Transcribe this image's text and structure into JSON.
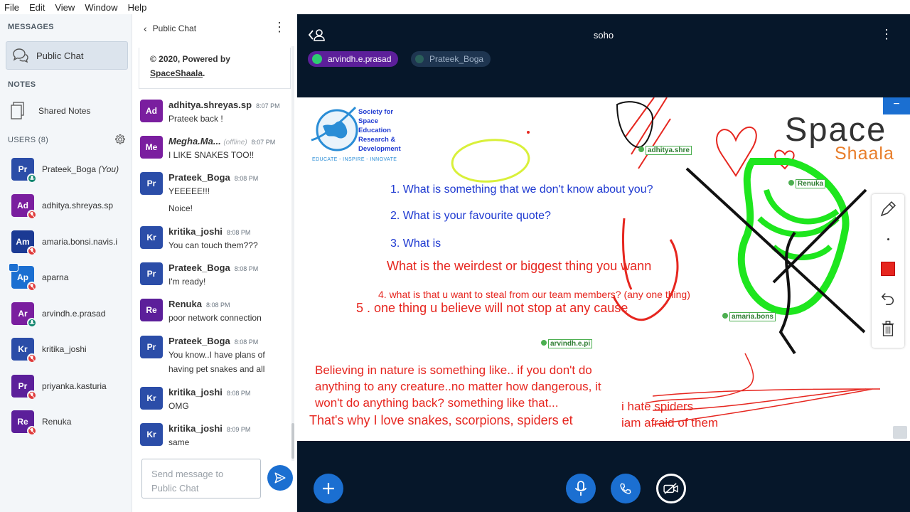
{
  "menu": [
    "File",
    "Edit",
    "View",
    "Window",
    "Help"
  ],
  "sidebar": {
    "messages_label": "MESSAGES",
    "public_chat": "Public Chat",
    "notes_label": "NOTES",
    "shared_notes": "Shared Notes",
    "users_label": "USERS (8)",
    "users": [
      {
        "initials": "Pr",
        "name": "Prateek_Boga",
        "suffix": " (You)",
        "color": "#2b4da8",
        "badge": "mic"
      },
      {
        "initials": "Ad",
        "name": "adhitya.shreyas.sp",
        "color": "#7a1e9f",
        "badge": "muted"
      },
      {
        "initials": "Am",
        "name": "amaria.bonsi.navis.i",
        "color": "#1b3a94",
        "badge": "muted"
      },
      {
        "initials": "Ap",
        "name": "aparna",
        "color": "#1b6fd1",
        "badge": "muted"
      },
      {
        "initials": "Ar",
        "name": "arvindh.e.prasad",
        "color": "#7a1e9f",
        "badge": "mic"
      },
      {
        "initials": "Kr",
        "name": "kritika_joshi",
        "color": "#2b4da8",
        "badge": "muted"
      },
      {
        "initials": "Pr",
        "name": "priyanka.kasturia",
        "color": "#5c1f9a",
        "badge": "muted"
      },
      {
        "initials": "Re",
        "name": "Renuka",
        "color": "#5c1f9a",
        "badge": "muted"
      }
    ]
  },
  "chat": {
    "title": "Public Chat",
    "welcome_line1": "© 2020, Powered by",
    "welcome_line2": "SpaceShaala",
    "welcome_end": ".",
    "messages": [
      {
        "initials": "Ad",
        "color": "#7a1e9f",
        "name": "adhitya.shreyas.sp",
        "time": "8:07 PM",
        "lines": [
          "Prateek back !"
        ]
      },
      {
        "initials": "Me",
        "color": "#7a1e9f",
        "name": "Megha.Ma...",
        "offline": "(offline)",
        "time": "8:07 PM",
        "lines": [
          "I LIKE SNAKES TOO!!"
        ]
      },
      {
        "initials": "Pr",
        "color": "#2b4da8",
        "name": "Prateek_Boga",
        "time": "8:08 PM",
        "lines": [
          "YEEEEE!!!",
          "Noice!"
        ]
      },
      {
        "initials": "Kr",
        "color": "#2b4da8",
        "name": "kritika_joshi",
        "time": "8:08 PM",
        "lines": [
          "You can touch them???"
        ]
      },
      {
        "initials": "Pr",
        "color": "#2b4da8",
        "name": "Prateek_Boga",
        "time": "8:08 PM",
        "lines": [
          "I'm ready!"
        ]
      },
      {
        "initials": "Re",
        "color": "#5c1f9a",
        "name": "Renuka",
        "time": "8:08 PM",
        "lines": [
          "poor network connection"
        ]
      },
      {
        "initials": "Pr",
        "color": "#2b4da8",
        "name": "Prateek_Boga",
        "time": "8:08 PM",
        "lines": [
          "You know..I have plans of",
          "having pet snakes and all"
        ]
      },
      {
        "initials": "Kr",
        "color": "#2b4da8",
        "name": "kritika_joshi",
        "time": "8:08 PM",
        "lines": [
          "OMG"
        ]
      },
      {
        "initials": "Kr",
        "color": "#2b4da8",
        "name": "kritika_joshi",
        "time": "8:09 PM",
        "lines": [
          "same"
        ]
      }
    ],
    "input_placeholder": "Send message to Public Chat"
  },
  "main": {
    "title": "soho",
    "talkers": [
      "arvindh.e.prasad",
      "Prateek_Boga"
    ],
    "slide": {
      "logo_line1": "Society for",
      "logo_line2": "Space",
      "logo_line3": "Education",
      "logo_line4": "Research &",
      "logo_line5": "Development",
      "logo_tag": "EDUCATE - INSPIRE - INNOVATE",
      "brand1": "Space",
      "brand2": "Shaala",
      "q1": "1. What is something that we don't know about you?",
      "q2": "2. What is your favourite quote?",
      "q3": "3. What is",
      "r1": "What is the weirdest or biggest thing you wann",
      "r2": "4. what is that u want to steal from our team members? (any one thing)",
      "r3": "5 . one thing u believe will not stop at any cause",
      "p1": "Believing in nature is something like.. if you don't do",
      "p2": "anything to any creature..no matter how dangerous, it",
      "p3": "won't do anything back? something like that...",
      "p4": "That's why I love snakes, scorpions, spiders et",
      "s1": "i hate spiders",
      "s2": "iam afraid of them",
      "cursors": [
        "adhitya.shre",
        "Renuka",
        "amaria.bons",
        "arvindh.e.pi"
      ]
    },
    "colors": {
      "accent": "#1b6fd1",
      "red": "#e6261f",
      "blue": "#1f3ad1",
      "green": "#1ee61e"
    }
  }
}
